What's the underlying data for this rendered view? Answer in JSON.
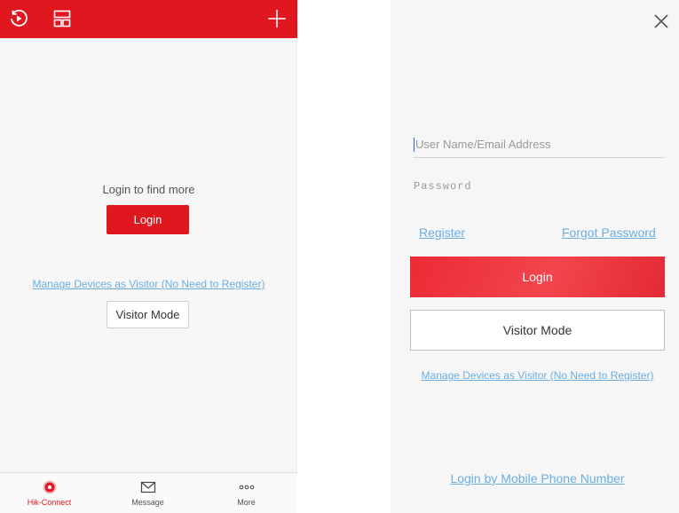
{
  "colors": {
    "brand_red": "#e0171f",
    "link_blue": "#6aaee3",
    "background": "#f6f6f6"
  },
  "left_screen": {
    "topbar": {
      "icons": [
        "playback-icon",
        "layout-icon",
        "add-icon"
      ]
    },
    "prompt": "Login to find more",
    "login_button": "Login",
    "visitor_link": "Manage Devices as Visitor (No Need to Register)",
    "visitor_button": "Visitor Mode",
    "bottom_nav": [
      {
        "label": "Hik-Connect",
        "icon": "hik-connect-icon",
        "active": true
      },
      {
        "label": "Message",
        "icon": "envelope-icon",
        "active": false
      },
      {
        "label": "More",
        "icon": "more-dots-icon",
        "active": false
      }
    ]
  },
  "right_screen": {
    "close_icon": "close-icon",
    "username_placeholder": "User Name/Email Address",
    "password_placeholder": "Password",
    "register_link": "Register",
    "forgot_link": "Forgot Password",
    "login_button": "Login",
    "visitor_button": "Visitor Mode",
    "visitor_link": "Manage Devices as Visitor (No Need to Register)",
    "phone_login_link": "Login by Mobile Phone Number"
  }
}
